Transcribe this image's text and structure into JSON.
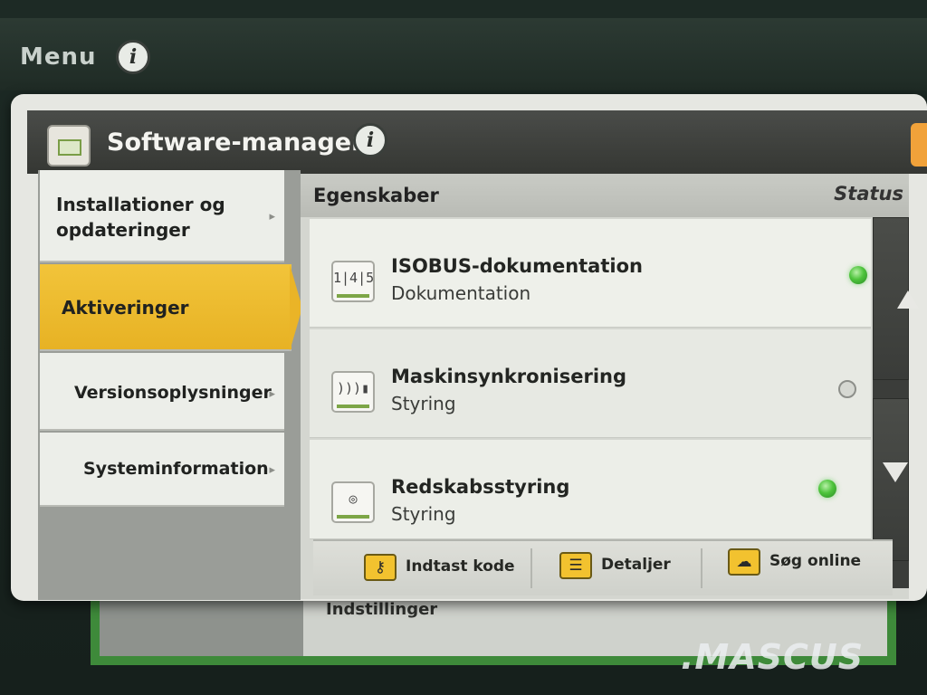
{
  "topbar": {
    "menu_label": "Menu",
    "info_icon": "info-icon"
  },
  "dialog": {
    "title": "Software-manager",
    "app_icon": "software-manager-icon",
    "info_icon": "info-icon"
  },
  "nav": {
    "items": [
      {
        "label": "Installationer og\nopdateringer",
        "has_arrow": true,
        "selected": false
      },
      {
        "label": "Aktiveringer",
        "has_arrow": false,
        "selected": true
      },
      {
        "label": "Versionsoplysninger",
        "has_arrow": true,
        "selected": false
      },
      {
        "label": "Systeminformation",
        "has_arrow": true,
        "selected": false
      }
    ],
    "arrow_glyph": "▸"
  },
  "content": {
    "columns": {
      "properties": "Egenskaber",
      "status": "Status"
    },
    "rows": [
      {
        "title": "ISOBUS-dokumentation",
        "subtitle": "Dokumentation",
        "status": "active",
        "icon": "isobus-doc-icon",
        "glyph": "1|4|5"
      },
      {
        "title": "Maskinsynkronisering",
        "subtitle": "Styring",
        "status": "inactive",
        "icon": "machine-sync-icon",
        "glyph": ")))▮"
      },
      {
        "title": "Redskabsstyring",
        "subtitle": "Styring",
        "status": "active",
        "icon": "implement-guidance-icon",
        "glyph": "◎"
      }
    ]
  },
  "toolbar": {
    "enter_code": "Indtast kode",
    "details": "Detaljer",
    "search_online": "Søg online",
    "enter_code_glyph": "⚷",
    "details_glyph": "☰",
    "search_online_glyph": "☁"
  },
  "background": {
    "under_text": "Indstillinger"
  },
  "watermark": ".MASCUS",
  "colors": {
    "selected_accent": "#eab427",
    "status_active": "#4ec43c",
    "brand_green": "#3e8a3a"
  }
}
